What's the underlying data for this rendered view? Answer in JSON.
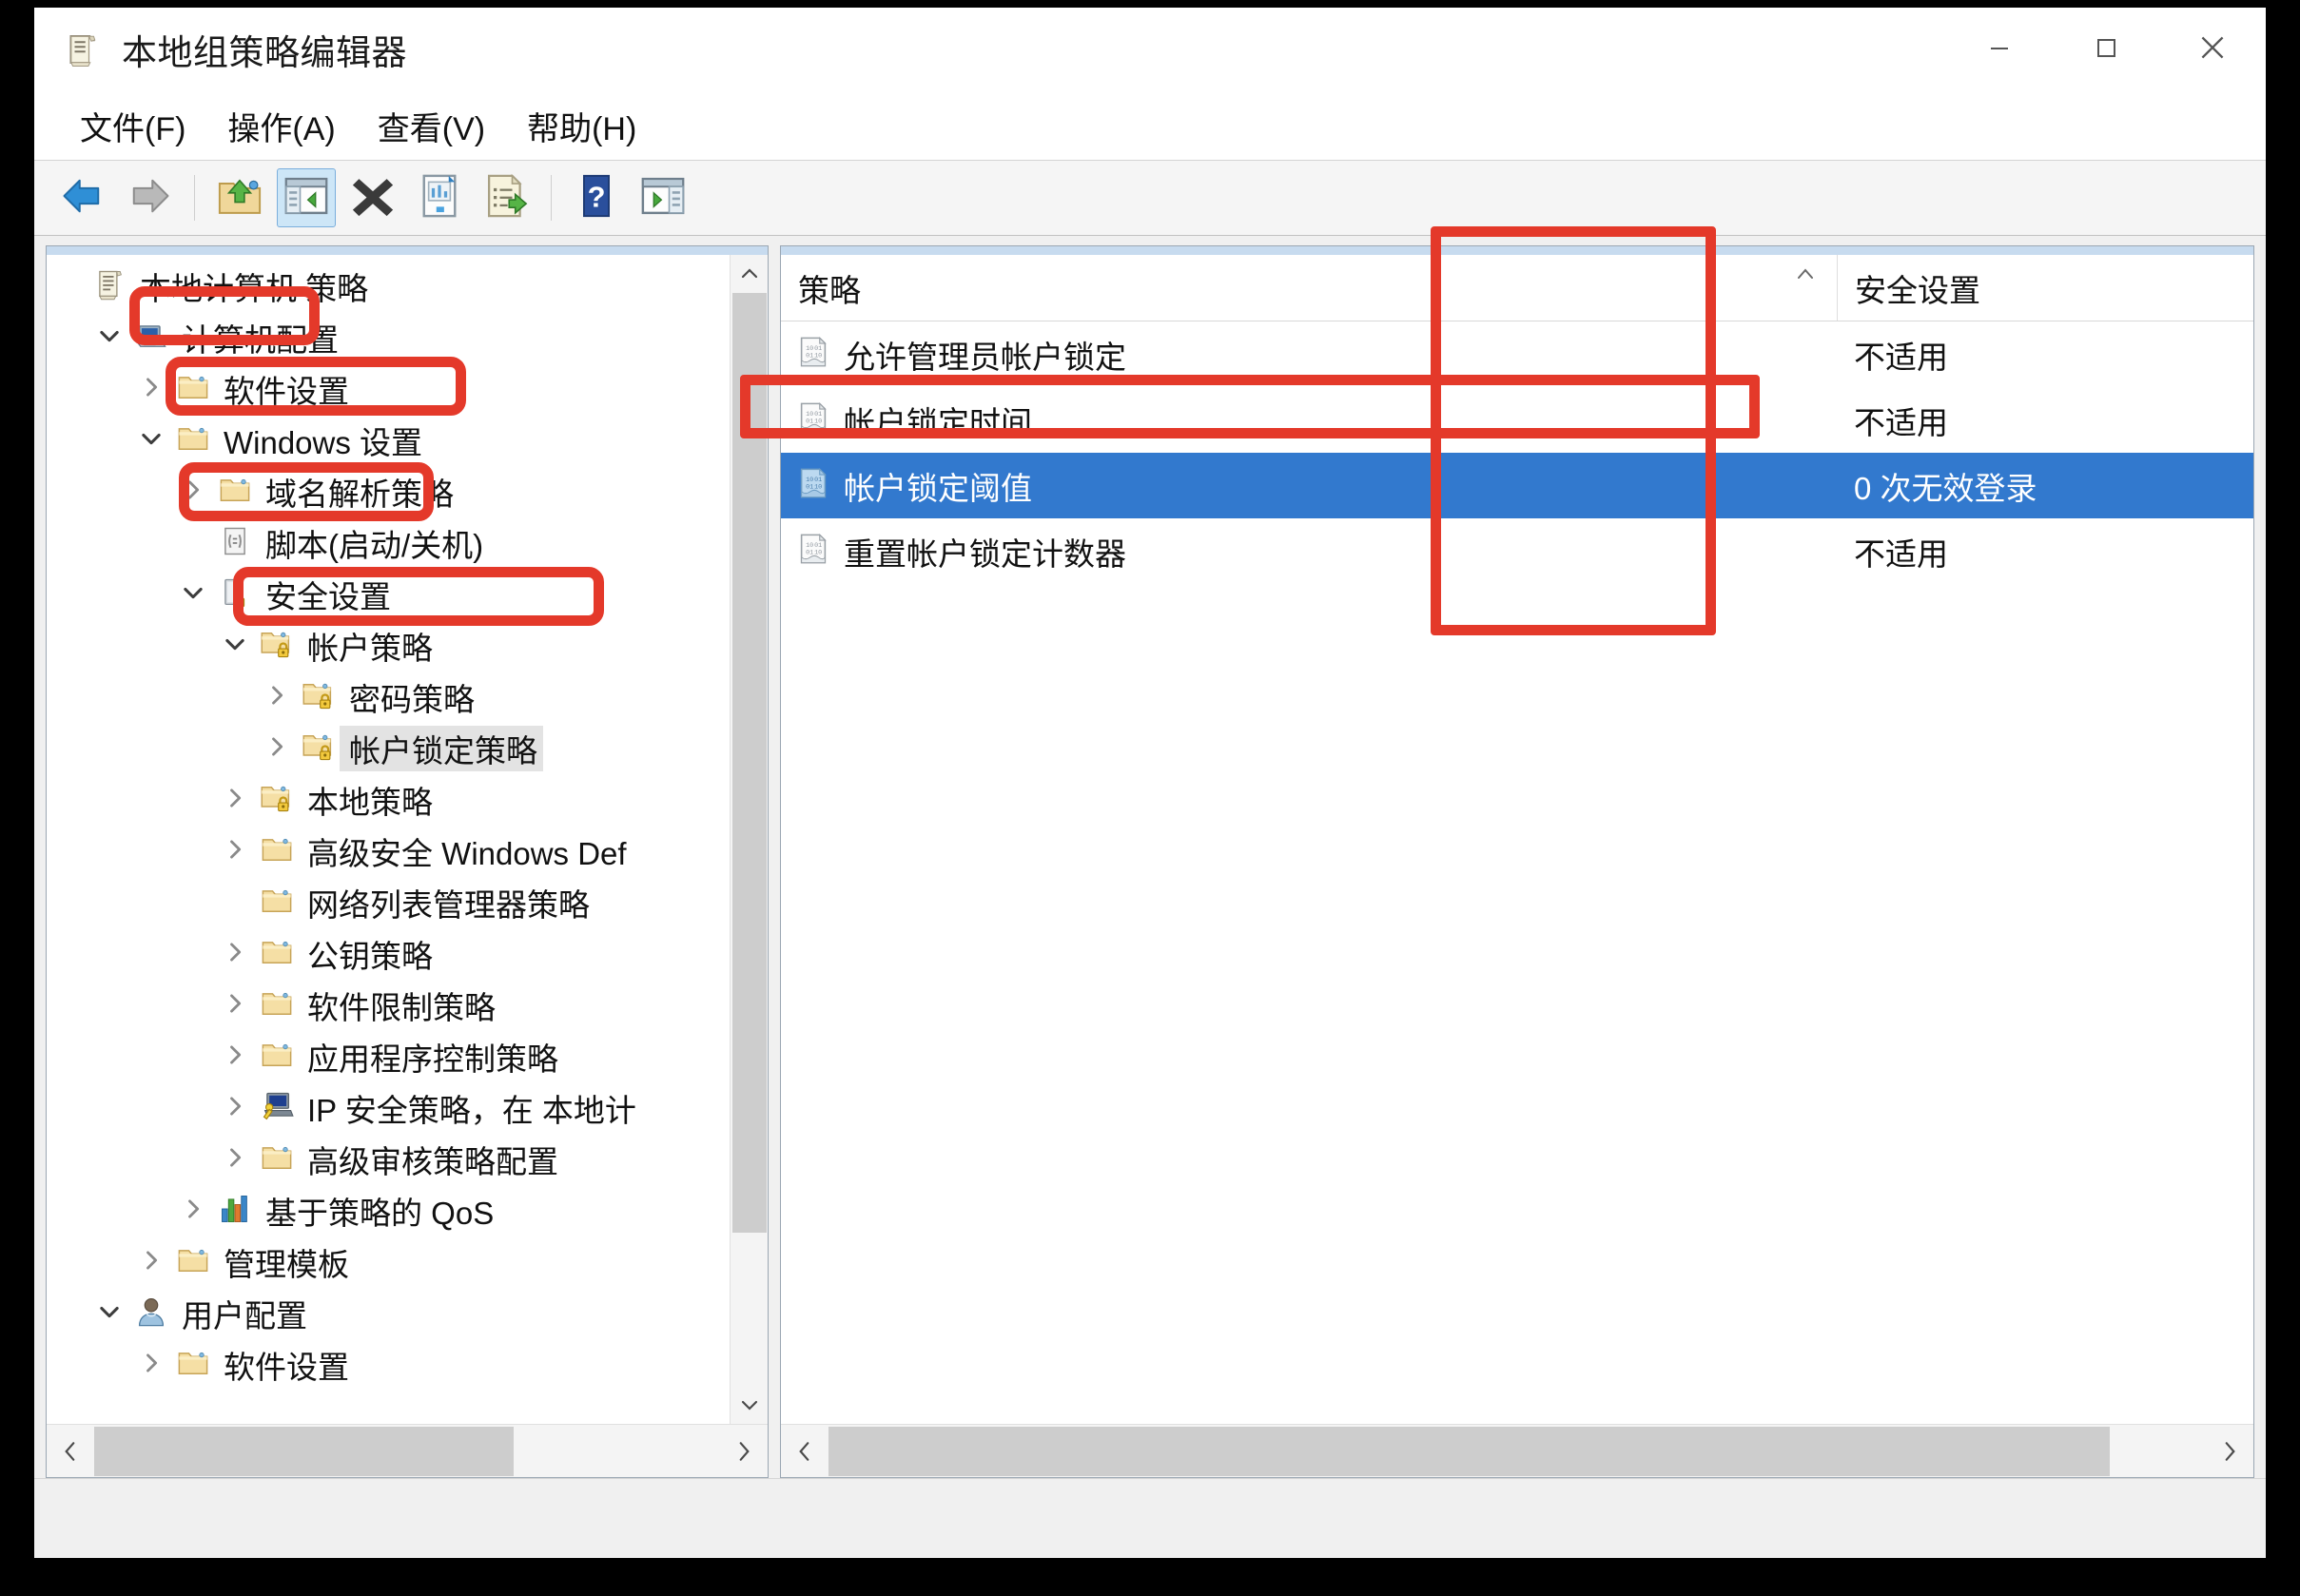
{
  "window": {
    "title": "本地组策略编辑器",
    "app_icon": "policy-scroll-icon",
    "controls": {
      "minimize": "minimize-icon",
      "maximize": "maximize-icon",
      "close": "close-icon"
    }
  },
  "menubar": {
    "items": [
      {
        "label": "文件(F)",
        "name": "menu-file"
      },
      {
        "label": "操作(A)",
        "name": "menu-action"
      },
      {
        "label": "查看(V)",
        "name": "menu-view"
      },
      {
        "label": "帮助(H)",
        "name": "menu-help"
      }
    ]
  },
  "toolbar": {
    "buttons": [
      {
        "icon": "back-arrow-icon",
        "name": "toolbar-back",
        "active": false
      },
      {
        "icon": "forward-arrow-icon",
        "name": "toolbar-forward",
        "active": false
      },
      {
        "icon": "separator",
        "name": "toolbar-separator-1",
        "active": false
      },
      {
        "icon": "up-folder-icon",
        "name": "toolbar-up-one-level",
        "active": false
      },
      {
        "icon": "show-hide-tree-icon",
        "name": "toolbar-show-hide-console-tree",
        "active": true
      },
      {
        "icon": "delete-x-icon",
        "name": "toolbar-delete",
        "active": false
      },
      {
        "icon": "properties-icon",
        "name": "toolbar-properties",
        "active": false
      },
      {
        "icon": "export-list-icon",
        "name": "toolbar-export-list",
        "active": false
      },
      {
        "icon": "separator",
        "name": "toolbar-separator-2",
        "active": false
      },
      {
        "icon": "help-question-icon",
        "name": "toolbar-help",
        "active": false
      },
      {
        "icon": "show-action-pane-icon",
        "name": "toolbar-show-action-pane",
        "active": false
      }
    ]
  },
  "tree": {
    "nodes": [
      {
        "label": "本地计算机 策略",
        "indent": 0,
        "twist": "none",
        "icon": "policy-scroll-icon",
        "selected": false
      },
      {
        "label": "计算机配置",
        "indent": 1,
        "twist": "down",
        "icon": "computer-icon",
        "selected": false
      },
      {
        "label": "软件设置",
        "indent": 2,
        "twist": "right",
        "icon": "folder-icon",
        "selected": false
      },
      {
        "label": "Windows 设置",
        "indent": 2,
        "twist": "down",
        "icon": "folder-icon",
        "selected": false
      },
      {
        "label": "域名解析策略",
        "indent": 3,
        "twist": "right",
        "icon": "folder-icon",
        "selected": false
      },
      {
        "label": "脚本(启动/关机)",
        "indent": 3,
        "twist": "none",
        "icon": "script-icon",
        "selected": false
      },
      {
        "label": "安全设置",
        "indent": 3,
        "twist": "down",
        "icon": "security-lock-icon",
        "selected": false
      },
      {
        "label": "帐户策略",
        "indent": 4,
        "twist": "down",
        "icon": "folder-lock-icon",
        "selected": false
      },
      {
        "label": "密码策略",
        "indent": 5,
        "twist": "right",
        "icon": "folder-lock-icon",
        "selected": false
      },
      {
        "label": "帐户锁定策略",
        "indent": 5,
        "twist": "right",
        "icon": "folder-lock-icon",
        "selected": true
      },
      {
        "label": "本地策略",
        "indent": 4,
        "twist": "right",
        "icon": "folder-lock-icon",
        "selected": false
      },
      {
        "label": "高级安全 Windows Def",
        "indent": 4,
        "twist": "right",
        "icon": "folder-icon",
        "selected": false
      },
      {
        "label": "网络列表管理器策略",
        "indent": 4,
        "twist": "none",
        "icon": "folder-icon",
        "selected": false
      },
      {
        "label": "公钥策略",
        "indent": 4,
        "twist": "right",
        "icon": "folder-icon",
        "selected": false
      },
      {
        "label": "软件限制策略",
        "indent": 4,
        "twist": "right",
        "icon": "folder-icon",
        "selected": false
      },
      {
        "label": "应用程序控制策略",
        "indent": 4,
        "twist": "right",
        "icon": "folder-icon",
        "selected": false
      },
      {
        "label": "IP 安全策略，在 本地计",
        "indent": 4,
        "twist": "right",
        "icon": "ip-security-icon",
        "selected": false
      },
      {
        "label": "高级审核策略配置",
        "indent": 4,
        "twist": "right",
        "icon": "folder-icon",
        "selected": false
      },
      {
        "label": "基于策略的 QoS",
        "indent": 3,
        "twist": "right",
        "icon": "qos-chart-icon",
        "selected": false
      },
      {
        "label": "管理模板",
        "indent": 2,
        "twist": "right",
        "icon": "folder-icon",
        "selected": false
      },
      {
        "label": "用户配置",
        "indent": 1,
        "twist": "down",
        "icon": "user-icon",
        "selected": false
      },
      {
        "label": "软件设置",
        "indent": 2,
        "twist": "right",
        "icon": "folder-icon",
        "selected": false
      }
    ],
    "scrollbar": {
      "up_icon": "chevron-up-icon",
      "down_icon": "chevron-down-icon",
      "left_icon": "chevron-left-icon",
      "right_icon": "chevron-right-icon"
    }
  },
  "list": {
    "columns": [
      {
        "label": "策略",
        "name": "column-policy",
        "sort": "ascending"
      },
      {
        "label": "安全设置",
        "name": "column-setting",
        "sort": "none"
      }
    ],
    "sort_indicator": "︿",
    "rows": [
      {
        "policy": "允许管理员帐户锁定",
        "setting": "不适用",
        "selected": false,
        "icon": "policy-setting-icon"
      },
      {
        "policy": "帐户锁定时间",
        "setting": "不适用",
        "selected": false,
        "icon": "policy-setting-icon"
      },
      {
        "policy": "帐户锁定阈值",
        "setting": "0 次无效登录",
        "selected": true,
        "icon": "policy-setting-icon"
      },
      {
        "policy": "重置帐户锁定计数器",
        "setting": "不适用",
        "selected": false,
        "icon": "policy-setting-icon"
      }
    ],
    "scrollbar": {
      "left_icon": "chevron-left-icon",
      "right_icon": "chevron-right-icon"
    }
  },
  "statusbar": {
    "text": ""
  },
  "annotations": {
    "color": "#e4392a",
    "boxes": [
      {
        "name": "annotation-computer-configuration"
      },
      {
        "name": "annotation-windows-settings"
      },
      {
        "name": "annotation-security-settings"
      },
      {
        "name": "annotation-account-lockout-policy"
      },
      {
        "name": "annotation-security-setting-column"
      },
      {
        "name": "annotation-account-lockout-threshold-row"
      }
    ]
  }
}
